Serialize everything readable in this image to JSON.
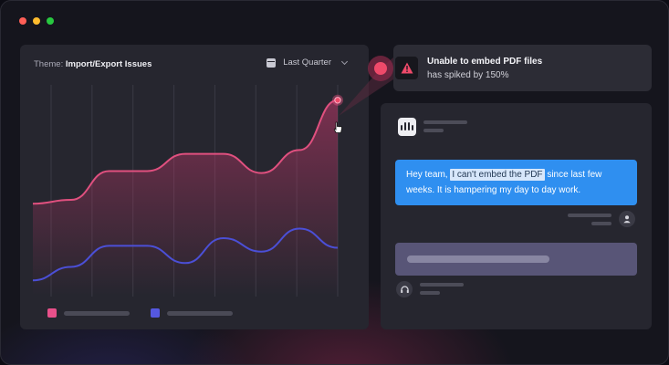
{
  "window": {
    "controls": [
      "close",
      "minimize",
      "maximize"
    ]
  },
  "chart_panel": {
    "theme_prefix": "Theme: ",
    "theme_value": "Import/Export Issues",
    "date_range": "Last Quarter",
    "calendar_icon": "calendar-icon",
    "dropdown_icon": "chevron-down-icon"
  },
  "chart_data": {
    "type": "area",
    "x": [
      0,
      1,
      2,
      3,
      4,
      5,
      6,
      7,
      8
    ],
    "series": [
      {
        "color": "#e0507f",
        "fill": "area",
        "values": [
          0.48,
          0.5,
          0.65,
          0.65,
          0.74,
          0.74,
          0.64,
          0.76,
          1.02
        ]
      },
      {
        "color": "#4b4fd6",
        "fill": "none",
        "values": [
          0.08,
          0.15,
          0.26,
          0.26,
          0.17,
          0.3,
          0.23,
          0.35,
          0.25
        ]
      }
    ],
    "highlight": {
      "series": 0,
      "index": 8
    },
    "ylim": [
      0,
      1.1
    ],
    "grid": "vertical",
    "legend": "bottom-left",
    "gridlines": 8
  },
  "colors": {
    "accent_pink": "#e0507f",
    "accent_blue": "#4b4fd6",
    "bubble_blue": "#2f8ff0",
    "alert_red": "#ef4a6a"
  },
  "alert": {
    "title": "Unable to embed PDF files",
    "subtitle": "has spiked by 150%",
    "icon": "warning-icon"
  },
  "chat": {
    "logo": "intercom-logo",
    "message_before": "Hey team, ",
    "message_highlight": "I can't embed the PDF",
    "message_after": " since last few weeks. It is hampering my day to day work.",
    "user_icon": "user-icon",
    "agent_icon": "headset-icon"
  }
}
